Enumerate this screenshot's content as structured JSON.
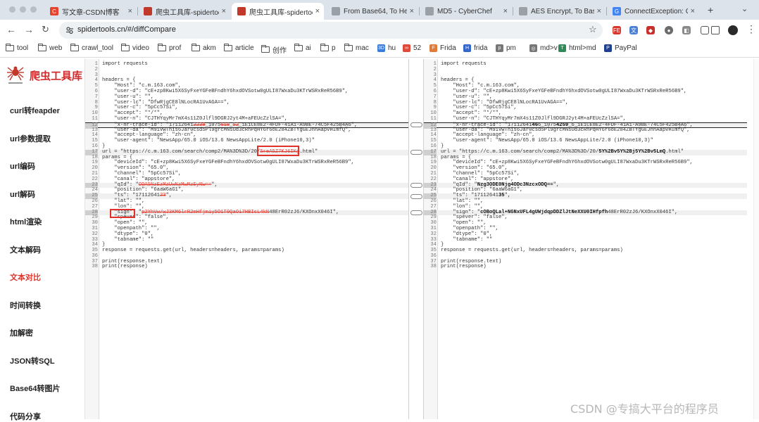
{
  "tabs": [
    {
      "title": "写文章-CSDN博客",
      "icon": "csdn-icon",
      "color": "#e8432f",
      "glyph": "C"
    },
    {
      "title": "爬虫工具库-spidertools",
      "icon": "spider-icon",
      "color": "#c0392b",
      "glyph": ""
    },
    {
      "title": "爬虫工具库-spidertools",
      "icon": "spider-icon",
      "color": "#c0392b",
      "glyph": "",
      "active": true
    },
    {
      "title": "From Base64, To Hex",
      "icon": "cyberchef-icon",
      "color": "#9aa0a6",
      "glyph": ""
    },
    {
      "title": "MD5 - CyberChef",
      "icon": "cyberchef-icon",
      "color": "#9aa0a6",
      "glyph": ""
    },
    {
      "title": "AES Encrypt, To Base",
      "icon": "cyberchef-icon",
      "color": "#9aa0a6",
      "glyph": ""
    },
    {
      "title": "ConnectException: C",
      "icon": "google-icon",
      "color": "#4285f4",
      "glyph": "G"
    }
  ],
  "toolbar": {
    "url": "spidertools.cn/#/diffCompare"
  },
  "bookmarks": [
    {
      "label": "tool",
      "icon": "folder-icon"
    },
    {
      "label": "web",
      "icon": "folder-icon"
    },
    {
      "label": "crawl_tool",
      "icon": "folder-icon"
    },
    {
      "label": "video",
      "icon": "folder-icon"
    },
    {
      "label": "prof",
      "icon": "folder-icon"
    },
    {
      "label": "akm",
      "icon": "folder-icon"
    },
    {
      "label": "article",
      "icon": "folder-icon"
    },
    {
      "label": "创作",
      "icon": "folder-icon"
    },
    {
      "label": "ai",
      "icon": "folder-icon"
    },
    {
      "label": "p",
      "icon": "folder-icon"
    },
    {
      "label": "mac",
      "icon": "folder-icon"
    },
    {
      "label": "hu",
      "icon": "badge-icon",
      "color": "#3b7ddd",
      "glyph": "3D"
    },
    {
      "label": "52",
      "icon": "badge-icon",
      "color": "#e04a3a",
      "glyph": "∞"
    },
    {
      "label": "Frida",
      "icon": "badge-icon",
      "color": "#e07b39",
      "glyph": "F"
    },
    {
      "label": "frida",
      "icon": "badge-icon",
      "color": "#3467c7",
      "glyph": "H"
    },
    {
      "label": "pm",
      "icon": "badge-icon",
      "color": "#777777",
      "glyph": "p"
    },
    {
      "label": "md>v",
      "icon": "badge-icon",
      "color": "#777777",
      "glyph": "◎"
    },
    {
      "label": "html>md",
      "icon": "badge-icon",
      "color": "#2e8b57",
      "glyph": "T"
    },
    {
      "label": "PayPal",
      "icon": "badge-icon",
      "color": "#1f3f8f",
      "glyph": "P"
    }
  ],
  "sidebar": {
    "logo_text": "爬虫工具库",
    "items": [
      {
        "label": "curl转feapder"
      },
      {
        "label": "url参数提取"
      },
      {
        "label": "url编码"
      },
      {
        "label": "url解码"
      },
      {
        "label": "html渲染"
      },
      {
        "label": "文本解码"
      },
      {
        "label": "文本对比",
        "active": true
      },
      {
        "label": "时间转换"
      },
      {
        "label": "加解密"
      },
      {
        "label": "JSON转SQL"
      },
      {
        "label": "Base64转图片"
      },
      {
        "label": "代码分享"
      }
    ]
  },
  "left_lines": [
    [
      {
        "t": "import requests"
      }
    ],
    [
      {
        "t": ""
      }
    ],
    [
      {
        "t": ""
      }
    ],
    [
      {
        "t": "headers = {"
      }
    ],
    [
      {
        "t": "    \"Host\": \"c.m.163.com\","
      }
    ],
    [
      {
        "t": "    \"user-d\": \"cE+zp8Kwi5X6SyFxeYGFeBFndhY6hxdOVSotw0gULI87WxaDu3KTrWSRxReR56B9\","
      }
    ],
    [
      {
        "t": "    \"user-u\": \"\","
      }
    ],
    [
      {
        "t": "    \"user-lc\": \"DfwRjgCE8lNLocRA1UvAGA==\","
      }
    ],
    [
      {
        "t": "    \"user-c\": \"5pCc57Si\","
      }
    ],
    [
      {
        "t": "    \"accept\": \"*/*\","
      }
    ],
    [
      {
        "t": "    \"user-n\": \"CJTHYqyMr7mX4s11Z0Jlfl9DGRJ2yt4M+aFEUcZzlSA=\","
      }
    ],
    [
      {
        "t": "    \"x-nr-trace-id\": \"17112641"
      },
      {
        "t": "2239",
        "c": "del"
      },
      {
        "t": "_1075"
      },
      {
        "t": "618",
        "c": "del"
      },
      {
        "t": "_"
      },
      {
        "t": "52",
        "c": "del"
      },
      {
        "t": "_1E1CE8E2-4FDF-41A1-A9BE-74C5F425B4A6\","
      }
    ],
    [
      {
        "t": "    \"user-da\": \"M91VwThis6Jar0csd5Pl9grcMNsOd3cRhPqHY6r6oE284ZBTYgGEJnnAapvHImfQ\","
      }
    ],
    [
      {
        "t": "    \"accept-language\": \"zh-cn\","
      }
    ],
    [
      {
        "t": "    \"user-agent\": \"NewsApp/65.0 iOS/13.6 NewsAppLite/2.0 (iPhone10,3)\""
      }
    ],
    [
      {
        "t": "}"
      }
    ],
    [
      {
        "t": "url = \"https://c.m.163.com/search/comp2/MA%3D%3D/20/"
      },
      {
        "t": "5reA5Z7KJ6IKg",
        "c": "del"
      },
      {
        "t": ".html\""
      }
    ],
    [
      {
        "t": "params = {"
      }
    ],
    [
      {
        "t": "    \"deviceId\": \"cE+zp8Kwi5X6SyFxeYGFeBFndhY6hxdOVSotw0gULI87WxaDu3KTrWSRxReR56B9\","
      }
    ],
    [
      {
        "t": "    \"version\": \"65.0\","
      }
    ],
    [
      {
        "t": "    \"channel\": \"5pCc57Si\","
      }
    ],
    [
      {
        "t": "    \"canal\": \"appstore\","
      }
    ],
    [
      {
        "t": "    \"qId\": \""
      },
      {
        "t": "ODA5NzEzMzUwNzMwMzEyNw==",
        "c": "del"
      },
      {
        "t": "\","
      }
    ],
    [
      {
        "t": "    \"position\": \"6aaW6aG1\","
      }
    ],
    [
      {
        "t": "    \"ts\": \"17112641"
      },
      {
        "t": "23",
        "c": "del"
      },
      {
        "t": "\","
      }
    ],
    [
      {
        "t": "    \"lat\": \"\","
      }
    ],
    [
      {
        "t": "    \"lon\": \"\","
      }
    ],
    [
      {
        "t": "    \"sign\": \""
      },
      {
        "t": "p2YhVw/wJ3KM6lrR2mHfjmiy5O1T0QaOi7HBIsL4kN",
        "c": "del"
      },
      {
        "t": "48ErR02zJ6/KXOnxX046I\","
      }
    ],
    [
      {
        "t": "    \"spever\": \"false\","
      }
    ],
    [
      {
        "t": "    \"open\": \"\","
      }
    ],
    [
      {
        "t": "    \"openpath\": \"\","
      }
    ],
    [
      {
        "t": "    \"dtype\": \"0\","
      }
    ],
    [
      {
        "t": "    \"tabname\": \"\""
      }
    ],
    [
      {
        "t": "}"
      }
    ],
    [
      {
        "t": "response = requests.get(url, headers=headers, params=params)"
      }
    ],
    [
      {
        "t": ""
      }
    ],
    [
      {
        "t": "print(response.text)"
      }
    ],
    [
      {
        "t": "print(response)"
      }
    ]
  ],
  "right_lines": [
    [
      {
        "t": "import requests"
      }
    ],
    [
      {
        "t": ""
      }
    ],
    [
      {
        "t": ""
      }
    ],
    [
      {
        "t": "headers = {"
      }
    ],
    [
      {
        "t": "    \"Host\": \"c.m.163.com\","
      }
    ],
    [
      {
        "t": "    \"user-d\": \"cE+zp8Kwi5X6SyFxeYGFeBFndhY6hxdOVSotw0gULI87WxaDu3KTrWSRxReR56B9\","
      }
    ],
    [
      {
        "t": "    \"user-u\": \"\","
      }
    ],
    [
      {
        "t": "    \"user-lc\": \"DfwRjgCE8lNLocRA1UvAGA==\","
      }
    ],
    [
      {
        "t": "    \"user-c\": \"5pCc57Si\","
      }
    ],
    [
      {
        "t": "    \"accept\": \"*/*\","
      }
    ],
    [
      {
        "t": "    \"user-n\": \"CJTHYqyMr7mX4s11Z0Jlfl9DGRJ2yt4M+aFEUcZzlSA=\","
      }
    ],
    [
      {
        "t": "    \"x-nr-trace-id\": \"17112641"
      },
      {
        "t": "46",
        "c": "add"
      },
      {
        "t": "6_1075"
      },
      {
        "t": "4259",
        "c": "add"
      },
      {
        "t": "_6_1E1CE8E2-4FDF-41A1-A9BE-74C5F425B4A6\","
      }
    ],
    [
      {
        "t": "    \"user-da\": \"M91VwThis6Jar0csd5Pl9grcMNsOd3cRhPqHY6r6oE284ZBTYgGEJnnAapvHImfQ\","
      }
    ],
    [
      {
        "t": "    \"accept-language\": \"zh-cn\","
      }
    ],
    [
      {
        "t": "    \"user-agent\": \"NewsApp/65.0 iOS/13.6 NewsAppLite/2.0 (iPhone10,3)\""
      }
    ],
    [
      {
        "t": "}"
      }
    ],
    [
      {
        "t": "url = \"https://c.m.163.com/search/comp2/MA%3D%3D/20/"
      },
      {
        "t": "5Y%2Bv5Y%2Bj5Y%2Bv5LmQ",
        "c": "add"
      },
      {
        "t": ".html\""
      }
    ],
    [
      {
        "t": "params = {"
      }
    ],
    [
      {
        "t": "    \"deviceId\": \"cE+zp8Kwi5X6SyFxeYGFeBFndhY6hxdOVSotw0gULI87WxaDu3KTrWSRxReR56B9\","
      }
    ],
    [
      {
        "t": "    \"version\": \"65.0\","
      }
    ],
    [
      {
        "t": "    \"channel\": \"5pCc57Si\","
      }
    ],
    [
      {
        "t": "    \"canal\": \"appstore\","
      }
    ],
    [
      {
        "t": "    \"qId\": \""
      },
      {
        "t": "Nzg3ODE0Njg4ODc3NzcxODQ==",
        "c": "add"
      },
      {
        "t": "\","
      }
    ],
    [
      {
        "t": "    \"position\": \"6aaW6aG1\","
      }
    ],
    [
      {
        "t": "    \"ts\": \"17112641"
      },
      {
        "t": "35",
        "c": "add"
      },
      {
        "t": "\","
      }
    ],
    [
      {
        "t": "    \"lat\": \"\","
      }
    ],
    [
      {
        "t": "    \"lon\": \"\","
      }
    ],
    [
      {
        "t": "    \"sign\": \""
      },
      {
        "t": "cOBoQLal+NGNxUFL4gUWjdqpDDZlJtNeXXU0IHfpfh",
        "c": "add"
      },
      {
        "t": "48ErR02zJ6/KXOnxX046I\","
      }
    ],
    [
      {
        "t": "    \"spever\": \"false\","
      }
    ],
    [
      {
        "t": "    \"open\": \"\","
      }
    ],
    [
      {
        "t": "    \"openpath\": \"\","
      }
    ],
    [
      {
        "t": "    \"dtype\": \"0\","
      }
    ],
    [
      {
        "t": "    \"tabname\": \"\""
      }
    ],
    [
      {
        "t": "}"
      }
    ],
    [
      {
        "t": "response = requests.get(url, headers=headers, params=params)"
      }
    ],
    [
      {
        "t": ""
      }
    ],
    [
      {
        "t": "print(response.text)"
      }
    ],
    [
      {
        "t": "print(response)"
      }
    ]
  ],
  "changed_lines": [
    12,
    17,
    23,
    25,
    28
  ],
  "watermark": "CSDN @专搞大平台的程序员"
}
